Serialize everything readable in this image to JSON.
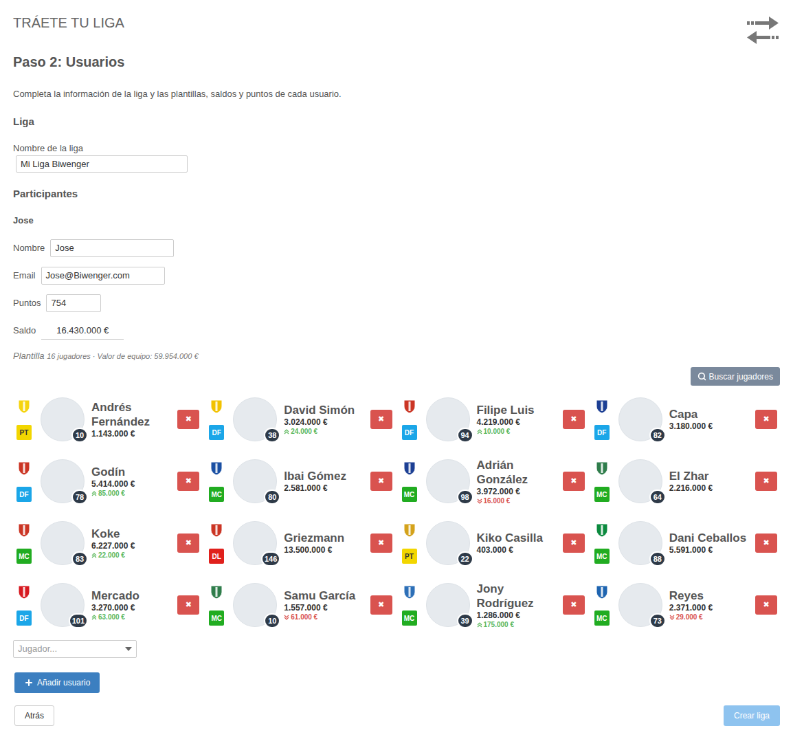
{
  "header": {
    "title": "TRÁETE TU LIGA"
  },
  "step": {
    "title": "Paso 2: Usuarios",
    "description": "Completa la información de la liga y las plantillas, saldos y puntos de cada usuario."
  },
  "league": {
    "heading": "Liga",
    "name_label": "Nombre de la liga",
    "name_value": "Mi Liga Biwenger"
  },
  "participants": {
    "heading": "Participantes",
    "users": [
      {
        "title": "Jose",
        "fields": [
          {
            "label": "Nombre",
            "value": "Jose",
            "kind": "text"
          },
          {
            "label": "Email",
            "value": "Jose@Biwenger.com",
            "kind": "email"
          },
          {
            "label": "Puntos",
            "value": "754",
            "kind": "number"
          },
          {
            "label": "Saldo",
            "value": "16.430.000 €",
            "kind": "money"
          }
        ],
        "squad": {
          "label": "Plantilla",
          "summary": "16 jugadores · Valor de equipo: 59.954.000 €"
        },
        "search_button": "Buscar jugadores",
        "remove_glyph": "✖",
        "players": [
          {
            "name": "Andrés Fernández",
            "position": "PT",
            "position_color": "#f2d600",
            "crest_color": "#f5d40f",
            "price": "1.143.000 €",
            "rating": "10"
          },
          {
            "name": "David Simón",
            "position": "DF",
            "position_color": "#1ba6e8",
            "crest_color": "#f2c200",
            "price": "3.024.000 €",
            "rating": "38",
            "change": {
              "text": "24.000 €",
              "direction": "up"
            }
          },
          {
            "name": "Filipe Luis",
            "position": "DF",
            "position_color": "#1ba6e8",
            "crest_color": "#cb3524",
            "price": "4.219.000 €",
            "rating": "94",
            "change": {
              "text": "10.000 €",
              "direction": "up"
            }
          },
          {
            "name": "Capa",
            "position": "DF",
            "position_color": "#1ba6e8",
            "crest_color": "#1c3f94",
            "price": "3.180.000 €",
            "rating": "82"
          },
          {
            "name": "Godín",
            "position": "DF",
            "position_color": "#1ba6e8",
            "crest_color": "#cb3524",
            "price": "5.414.000 €",
            "rating": "78",
            "change": {
              "text": "85.000 €",
              "direction": "up"
            }
          },
          {
            "name": "Ibai Gómez",
            "position": "MC",
            "position_color": "#21ac21",
            "crest_color": "#1a4fa3",
            "price": "2.581.000 €",
            "rating": "80"
          },
          {
            "name": "Adrián González",
            "position": "MC",
            "position_color": "#21ac21",
            "crest_color": "#1c3f94",
            "price": "3.972.000 €",
            "rating": "98",
            "change": {
              "text": "16.000 €",
              "direction": "down"
            }
          },
          {
            "name": "El Zhar",
            "position": "MC",
            "position_color": "#21ac21",
            "crest_color": "#2f7d4b",
            "price": "2.216.000 €",
            "rating": "64"
          },
          {
            "name": "Koke",
            "position": "MC",
            "position_color": "#21ac21",
            "crest_color": "#cb3524",
            "price": "6.227.000 €",
            "rating": "83",
            "change": {
              "text": "22.000 €",
              "direction": "up"
            }
          },
          {
            "name": "Griezmann",
            "position": "DL",
            "position_color": "#e0201c",
            "crest_color": "#cb3524",
            "price": "13.500.000 €",
            "rating": "146"
          },
          {
            "name": "Kiko Casilla",
            "position": "PT",
            "position_color": "#f2d600",
            "crest_color": "#d4a21b",
            "price": "403.000 €",
            "rating": "22"
          },
          {
            "name": "Dani Ceballos",
            "position": "MC",
            "position_color": "#21ac21",
            "crest_color": "#0b8a3e",
            "price": "5.591.000 €",
            "rating": "88"
          },
          {
            "name": "Mercado",
            "position": "DF",
            "position_color": "#1ba6e8",
            "crest_color": "#d71920",
            "price": "3.270.000 €",
            "rating": "101",
            "change": {
              "text": "63.000 €",
              "direction": "up"
            }
          },
          {
            "name": "Samu García",
            "position": "MC",
            "position_color": "#21ac21",
            "crest_color": "#2f7d4b",
            "price": "1.557.000 €",
            "rating": "10",
            "change": {
              "text": "61.000 €",
              "direction": "down"
            }
          },
          {
            "name": "Jony Rodríguez",
            "position": "MC",
            "position_color": "#21ac21",
            "crest_color": "#2c6fb7",
            "price": "1.286.000 €",
            "rating": "39",
            "change": {
              "text": "175.000 €",
              "direction": "up"
            }
          },
          {
            "name": "Reyes",
            "position": "MC",
            "position_color": "#21ac21",
            "crest_color": "#1e64b0",
            "price": "2.371.000 €",
            "rating": "73",
            "change": {
              "text": "29.000 €",
              "direction": "down"
            }
          }
        ],
        "player_select": {
          "placeholder": "Jugador..."
        }
      }
    ]
  },
  "add_user_button": "Añadir usuario",
  "footer": {
    "back": "Atrás",
    "create": {
      "label": "Crear liga",
      "disabled": true
    }
  }
}
